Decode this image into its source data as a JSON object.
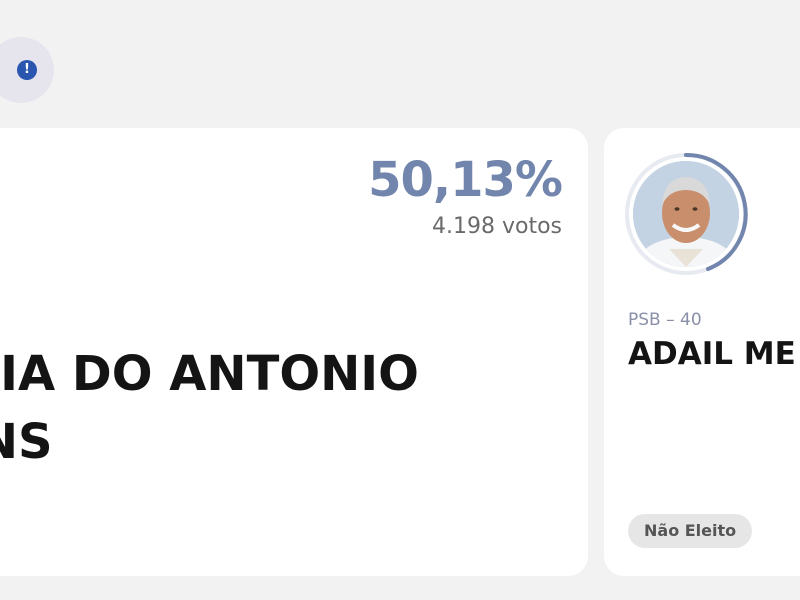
{
  "alert": {
    "icon": "exclamation-icon",
    "glyph": "!"
  },
  "left_card": {
    "percentage": "50,13%",
    "votes": "4.198 votos",
    "name_line1": "NIA DO ANTONIO",
    "name_line2": "INS"
  },
  "right_card": {
    "photo": "candidate-photo",
    "party": "PSB – 40",
    "name": "ADAIL ME",
    "status": "Não Eleito"
  },
  "colors": {
    "accent": "#7285ad",
    "alert": "#2a56b0",
    "background": "#f2f2f3",
    "card": "#ffffff"
  }
}
